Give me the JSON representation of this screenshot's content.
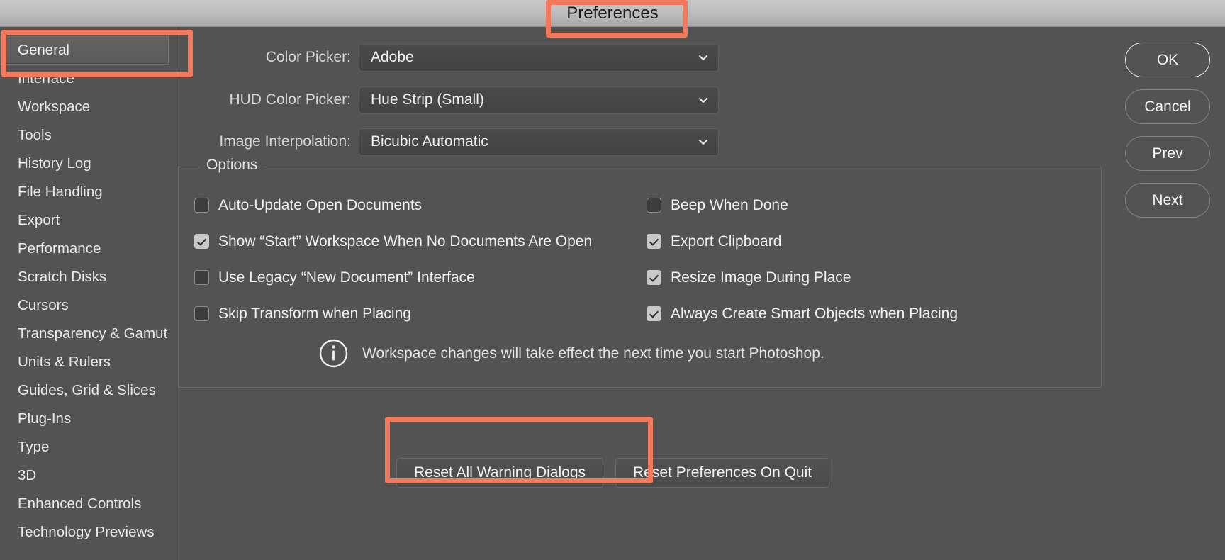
{
  "window": {
    "title": "Preferences"
  },
  "colors": {
    "highlight": "#f4795c",
    "dialog_bg": "#535353",
    "titlebar_bg": "#bcbcbc",
    "text": "#f0f0f0"
  },
  "sidebar": {
    "items": [
      {
        "label": "General",
        "selected": true
      },
      {
        "label": "Interface",
        "selected": false
      },
      {
        "label": "Workspace",
        "selected": false
      },
      {
        "label": "Tools",
        "selected": false
      },
      {
        "label": "History Log",
        "selected": false
      },
      {
        "label": "File Handling",
        "selected": false
      },
      {
        "label": "Export",
        "selected": false
      },
      {
        "label": "Performance",
        "selected": false
      },
      {
        "label": "Scratch Disks",
        "selected": false
      },
      {
        "label": "Cursors",
        "selected": false
      },
      {
        "label": "Transparency & Gamut",
        "selected": false
      },
      {
        "label": "Units & Rulers",
        "selected": false
      },
      {
        "label": "Guides, Grid & Slices",
        "selected": false
      },
      {
        "label": "Plug-Ins",
        "selected": false
      },
      {
        "label": "Type",
        "selected": false
      },
      {
        "label": "3D",
        "selected": false
      },
      {
        "label": "Enhanced Controls",
        "selected": false
      },
      {
        "label": "Technology Previews",
        "selected": false
      }
    ]
  },
  "main": {
    "fields": [
      {
        "label": "Color Picker:",
        "value": "Adobe",
        "icon": "chevron-down-icon"
      },
      {
        "label": "HUD Color Picker:",
        "value": "Hue Strip (Small)",
        "icon": "chevron-down-icon"
      },
      {
        "label": "Image Interpolation:",
        "value": "Bicubic Automatic",
        "icon": "chevron-down-icon"
      }
    ],
    "options": {
      "legend": "Options",
      "left_column": [
        {
          "label": "Auto-Update Open Documents",
          "checked": false
        },
        {
          "label": "Show “Start” Workspace When No Documents Are Open",
          "checked": true
        },
        {
          "label": "Use Legacy “New Document” Interface",
          "checked": false
        },
        {
          "label": "Skip Transform when Placing",
          "checked": false
        }
      ],
      "right_column": [
        {
          "label": "Beep When Done",
          "checked": false
        },
        {
          "label": "Export Clipboard",
          "checked": true
        },
        {
          "label": "Resize Image During Place",
          "checked": true
        },
        {
          "label": "Always Create Smart Objects when Placing",
          "checked": true
        }
      ],
      "note": {
        "icon": "info-icon",
        "text": "Workspace changes will take effect the next time you start Photoshop."
      }
    },
    "reset_buttons": [
      {
        "label": "Reset All Warning Dialogs",
        "highlighted": true
      },
      {
        "label": "Reset Preferences On Quit",
        "highlighted": false
      }
    ]
  },
  "actions": [
    {
      "label": "OK",
      "is_default": true
    },
    {
      "label": "Cancel",
      "is_default": false
    },
    {
      "label": "Prev",
      "is_default": false
    },
    {
      "label": "Next",
      "is_default": false
    }
  ],
  "highlights": [
    {
      "name": "title-highlight",
      "target": "Preferences"
    },
    {
      "name": "general-highlight",
      "target": "General"
    },
    {
      "name": "reset-warnings-highlight",
      "target": "Reset All Warning Dialogs"
    }
  ]
}
